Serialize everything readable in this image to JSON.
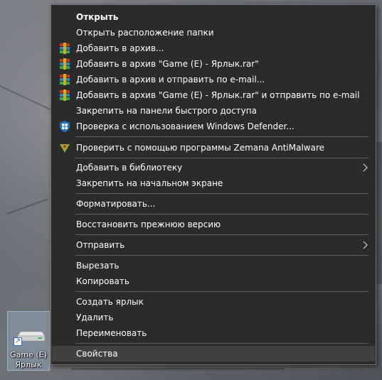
{
  "desktop": {
    "shortcut": {
      "label_line1": "Game (E)",
      "label_line2": "Ярлык",
      "icon": "drive-shortcut-icon"
    }
  },
  "context_menu": {
    "items": {
      "open": "Открыть",
      "open_folder": "Открыть расположение папки",
      "add_archive": "Добавить в архив...",
      "add_rar": "Добавить в архив \"Game (E) - Ярлык.rar\"",
      "add_email": "Добавить в архив и отправить по e-mail...",
      "add_rar_email": "Добавить в архив \"Game (E) - Ярлык.rar\" и отправить по e-mail",
      "pin_quick": "Закрепить на панели быстрого доступа",
      "defender": "Проверка с использованием Windows Defender...",
      "zemana": "Проверить с помощью программы Zemana AntiMalware",
      "library": "Добавить в библиотеку",
      "pin_start": "Закрепить на начальном экране",
      "format": "Форматировать...",
      "restore": "Восстановить прежнюю версию",
      "send_to": "Отправить",
      "cut": "Вырезать",
      "copy": "Копировать",
      "create_shortcut": "Создать ярлык",
      "delete": "Удалить",
      "rename": "Переименовать",
      "properties": "Свойства"
    },
    "icons": {
      "winrar": "winrar-icon",
      "defender": "windows-defender-icon",
      "zemana": "zemana-icon",
      "submenu": "chevron-right-icon"
    },
    "colors": {
      "background": "#2b2b2b",
      "hover": "#414141",
      "border": "#767676",
      "separator": "#5e5e5e"
    }
  }
}
